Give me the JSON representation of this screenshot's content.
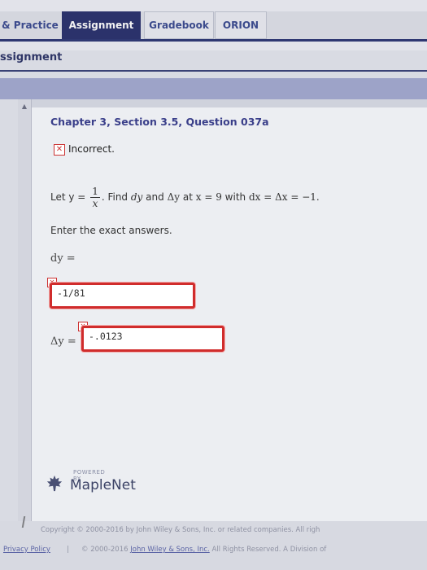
{
  "nav": {
    "tabs": [
      "& Practice",
      "Assignment",
      "Gradebook",
      "ORION"
    ],
    "active_tab": "Assignment"
  },
  "page": {
    "title": "ssignment"
  },
  "question": {
    "title": "Chapter 3, Section 3.5, Question 037a",
    "status": "Incorrect.",
    "status_icon": "x-mark-icon",
    "problem": {
      "prefix": "Let y =",
      "numerator": "1",
      "denominator": "x",
      "mid": ". Find",
      "dy": "dy",
      "and": "and",
      "delta_y": "Δy",
      "at": "at",
      "condition": "x = 9",
      "with": "with",
      "increment": "dx = Δx = −1."
    },
    "instructions": "Enter the exact answers.",
    "dy_label": "dy =",
    "dy_answer": "-1/81",
    "delta_label": "Δy =",
    "delta_answer": "-.0123"
  },
  "branding": {
    "powered_by": "POWERED BY",
    "name": "MapleNet"
  },
  "footer": {
    "copyright": "Copyright © 2000-2016 by John Wiley & Sons, Inc. or related companies. All righ",
    "privacy": "Privacy Policy",
    "separator": "|",
    "rights_prefix": "© 2000-2016",
    "rights_link": "John Wiley & Sons, Inc.",
    "rights_suffix": "All Rights Reserved. A Division of"
  },
  "colors": {
    "accent": "#2b326b",
    "error": "#d02c2c",
    "title": "#3a3f8a"
  }
}
